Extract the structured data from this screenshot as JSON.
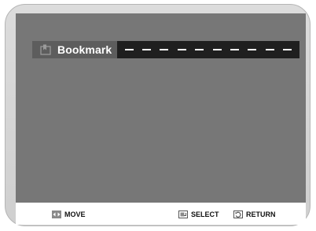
{
  "bookmark": {
    "title": "Bookmark",
    "slots": [
      "-",
      "-",
      "-",
      "-",
      "-",
      "-",
      "-",
      "-",
      "-",
      "-"
    ],
    "icon": "bookmark-icon"
  },
  "footer": {
    "move_label": "MOVE",
    "select_label": "SELECT",
    "return_label": "RETURN",
    "icons": {
      "move": "left-right-arrows-icon",
      "select": "enter-icon",
      "return": "return-icon"
    }
  },
  "colors": {
    "screen": "#777777",
    "bookmark_label_bg": "#5d5d5d",
    "bookmark_slots_bg": "#1f1f1f",
    "bezel": "#d6d6d6"
  }
}
